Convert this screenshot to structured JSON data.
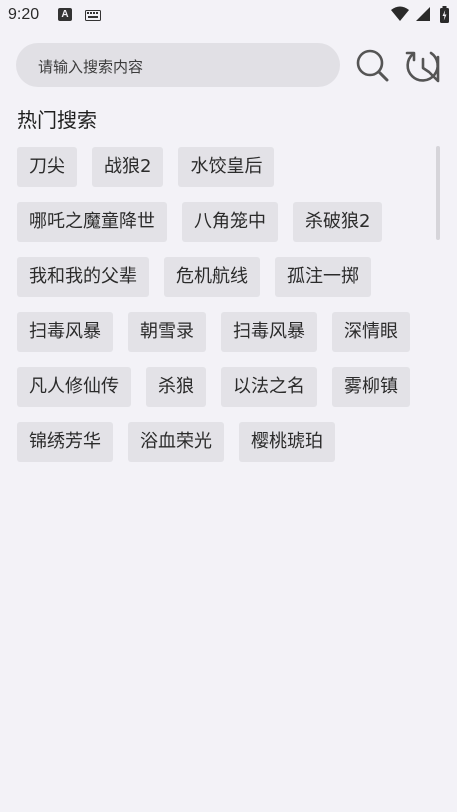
{
  "status": {
    "time": "9:20",
    "a_badge": "A",
    "icons": [
      "a-badge-icon",
      "keyboard-icon",
      "wifi-icon",
      "cell-signal-icon",
      "battery-icon"
    ]
  },
  "search": {
    "placeholder": "请输入搜索内容",
    "search_icon": "search-icon",
    "history_icon": "history-icon"
  },
  "hot": {
    "title": "热门搜索",
    "rows": [
      [
        "刀尖",
        "战狼2",
        "水饺皇后"
      ],
      [
        "哪吒之魔童降世",
        "八角笼中",
        "杀破狼2"
      ],
      [
        "我和我的父辈",
        "危机航线",
        "孤注一掷"
      ],
      [
        "扫毒风暴",
        "朝雪录",
        "扫毒风暴",
        "深情眼"
      ],
      [
        "凡人修仙传",
        "杀狼",
        "以法之名",
        "雾柳镇"
      ],
      [
        "锦绣芳华",
        "浴血荣光",
        "樱桃琥珀"
      ]
    ]
  },
  "colors": {
    "background": "#f3f2f7",
    "search_box": "#e1e0e5",
    "tag_bg": "#e3e2e7",
    "icon": "#555555"
  }
}
